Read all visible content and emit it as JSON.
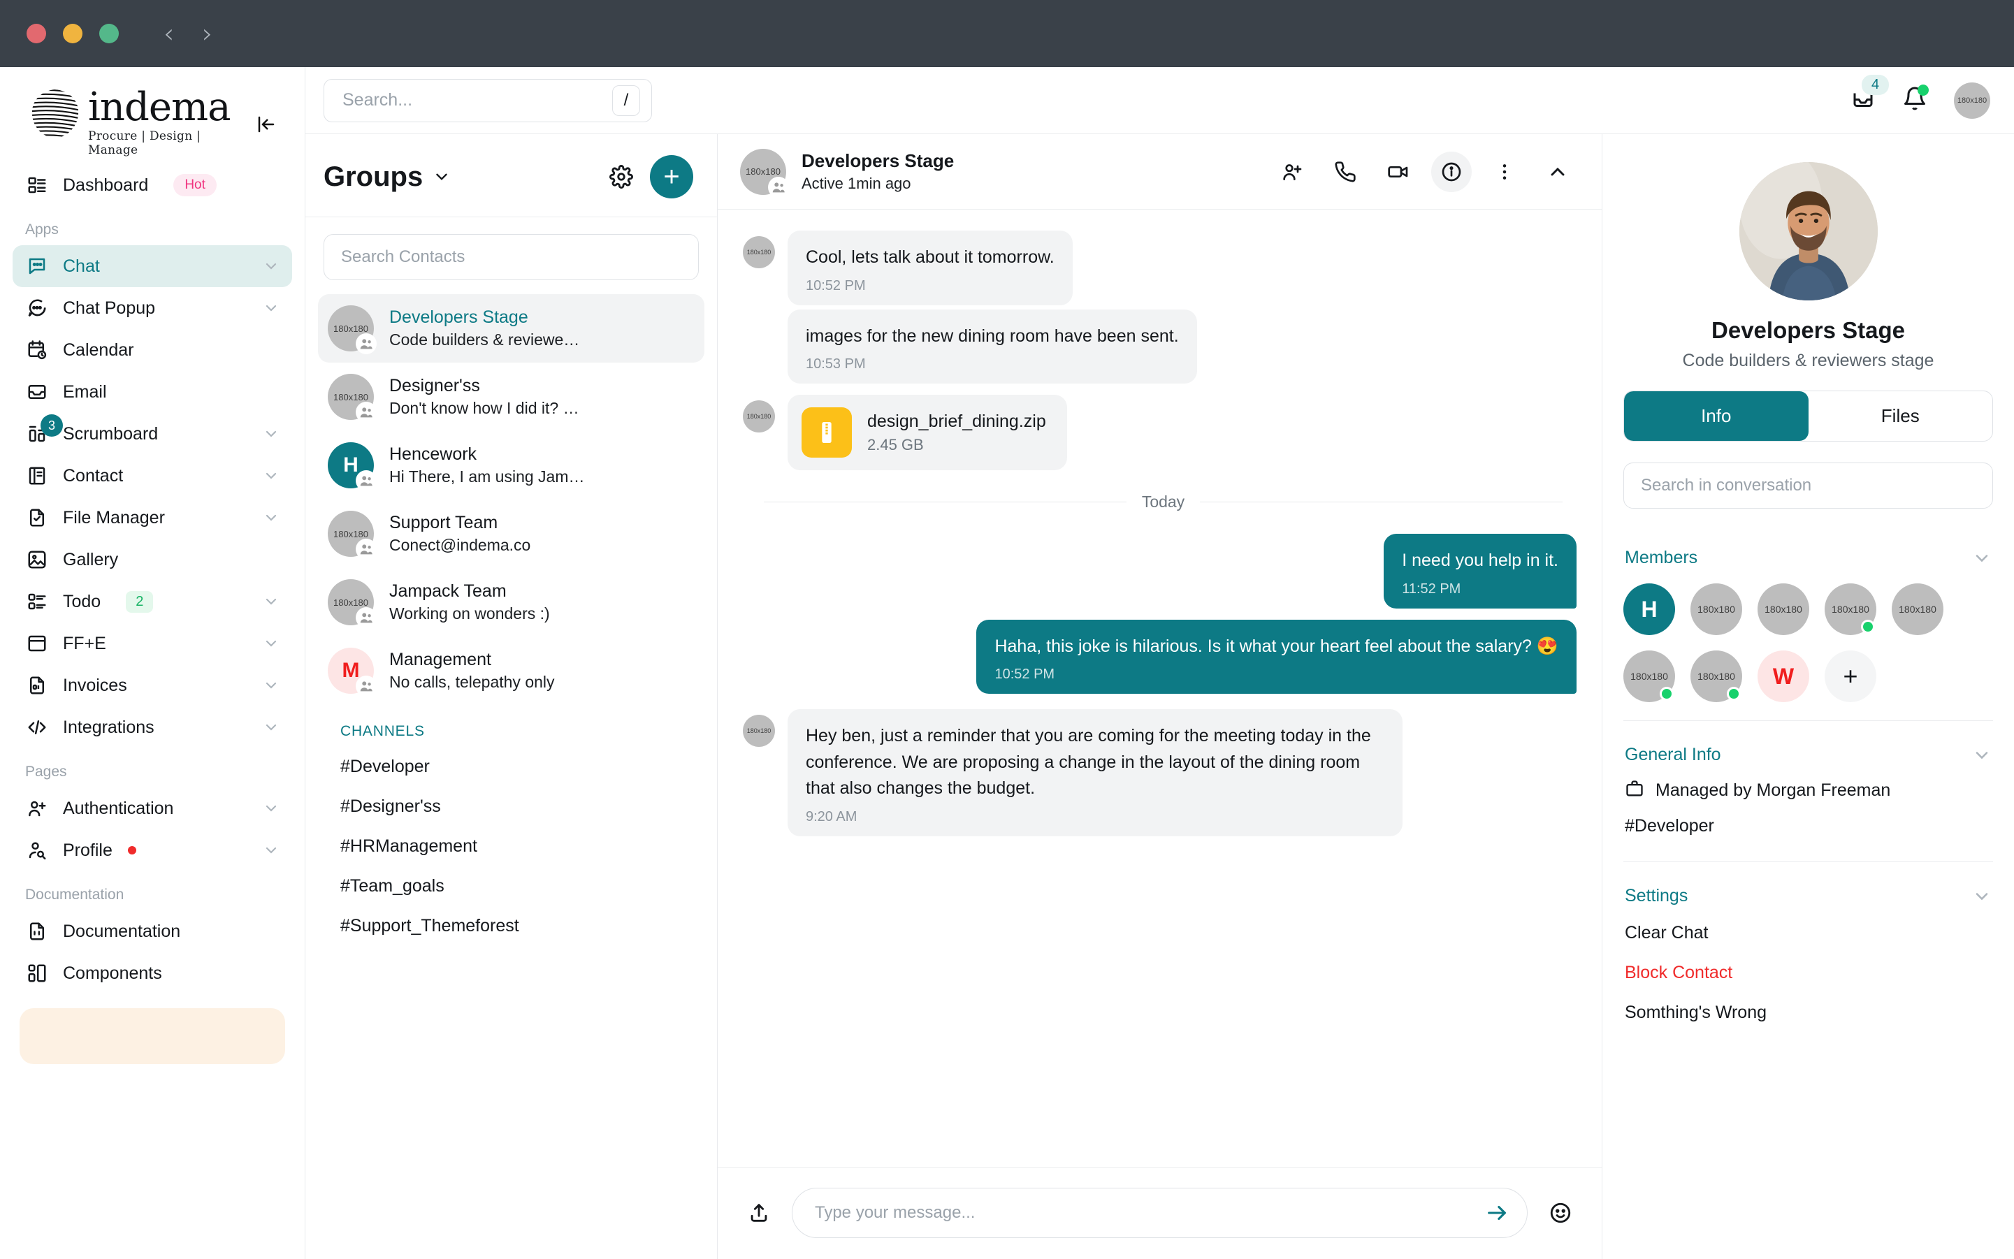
{
  "titlebar": {
    "traffic": [
      "close",
      "minimize",
      "maximize"
    ],
    "back_label": "‹",
    "forward_label": "›"
  },
  "sidebar": {
    "brand_name": "indema",
    "brand_tagline": "Procure | Design | Manage",
    "collapse_icon": "collapse-panel-icon",
    "dashboard": {
      "label": "Dashboard",
      "badge": "Hot"
    },
    "sections": [
      {
        "title": "Apps",
        "items": [
          {
            "label": "Chat",
            "icon": "chat-bubble-icon",
            "chevron": true,
            "active": true
          },
          {
            "label": "Chat Popup",
            "icon": "chat-dots-icon",
            "chevron": true
          },
          {
            "label": "Calendar",
            "icon": "calendar-clock-icon",
            "chevron": false
          },
          {
            "label": "Email",
            "icon": "inbox-icon",
            "chevron": false
          },
          {
            "label": "Scrumboard",
            "icon": "scrum-icon",
            "chevron": true,
            "badge": "3"
          },
          {
            "label": "Contact",
            "icon": "contact-book-icon",
            "chevron": true
          },
          {
            "label": "File Manager",
            "icon": "file-check-icon",
            "chevron": true
          },
          {
            "label": "Gallery",
            "icon": "image-icon",
            "chevron": false
          },
          {
            "label": "Todo",
            "icon": "todo-list-icon",
            "chevron": true,
            "count": "2"
          },
          {
            "label": "FF+E",
            "icon": "window-icon",
            "chevron": true
          },
          {
            "label": "Invoices",
            "icon": "invoice-icon",
            "chevron": true
          },
          {
            "label": "Integrations",
            "icon": "code-icon",
            "chevron": true
          }
        ]
      },
      {
        "title": "Pages",
        "items": [
          {
            "label": "Authentication",
            "icon": "user-plus-icon",
            "chevron": true
          },
          {
            "label": "Profile",
            "icon": "user-search-icon",
            "chevron": true,
            "dot": true
          }
        ]
      },
      {
        "title": "Documentation",
        "items": [
          {
            "label": "Documentation",
            "icon": "doc-code-icon",
            "chevron": false
          },
          {
            "label": "Components",
            "icon": "components-icon",
            "chevron": false
          }
        ]
      }
    ]
  },
  "topbar": {
    "search_placeholder": "Search...",
    "search_value": "",
    "search_shortcut": "/",
    "inbox_icon": "inbox-icon",
    "inbox_count": "4",
    "bell_icon": "bell-icon",
    "bell_has_alert": true,
    "user_avatar_label": "180x180"
  },
  "contacts_panel": {
    "title": "Groups",
    "title_chevron": "chevron-down-icon",
    "settings_icon": "gear-icon",
    "add_label": "+",
    "search_placeholder": "Search Contacts",
    "search_value": "",
    "items": [
      {
        "name": "Developers Stage",
        "preview": "Code builders & reviewe…",
        "avatar": "180x180",
        "avatar_kind": "image",
        "selected": true
      },
      {
        "name": "Designer'ss",
        "preview": "Don't know how I did it? …",
        "avatar": "180x180",
        "avatar_kind": "image"
      },
      {
        "name": "Hencework",
        "preview": "Hi There, I am using Jam…",
        "avatar": "H",
        "avatar_kind": "teal"
      },
      {
        "name": "Support Team",
        "preview": "Conect@indema.co",
        "avatar": "180x180",
        "avatar_kind": "image"
      },
      {
        "name": "Jampack Team",
        "preview": "Working on wonders :)",
        "avatar": "180x180",
        "avatar_kind": "image"
      },
      {
        "name": "Management",
        "preview": "No calls, telepathy only",
        "avatar": "M",
        "avatar_kind": "pink"
      }
    ],
    "channels_title": "CHANNELS",
    "channels": [
      "#Developer",
      "#Designer'ss",
      "#HRManagement",
      "#Team_goals",
      "#Support_Themeforest"
    ]
  },
  "chat": {
    "header": {
      "name": "Developers Stage",
      "status": "Active 1min ago",
      "avatar_label": "180x180",
      "actions": [
        {
          "name": "add-person-icon"
        },
        {
          "name": "phone-icon"
        },
        {
          "name": "video-icon"
        },
        {
          "name": "info-icon",
          "active": true
        },
        {
          "name": "more-vertical-icon"
        },
        {
          "name": "chevron-up-icon"
        }
      ]
    },
    "messages": [
      {
        "kind": "text",
        "dir": "in",
        "text": "Cool, lets talk about it tomorrow.",
        "time": "10:52 PM",
        "avatar_label": "180x180",
        "show_avatar": true
      },
      {
        "kind": "text",
        "dir": "in",
        "text": "images for the new dining room have been sent.",
        "time": "10:53 PM",
        "avatar_label": "180x180",
        "show_avatar": false
      },
      {
        "kind": "file",
        "dir": "in",
        "file_name": "design_brief_dining.zip",
        "file_size": "2.45 GB",
        "avatar_label": "180x180",
        "show_avatar": true,
        "file_icon": "zip-file-icon"
      },
      {
        "kind": "divider",
        "label": "Today"
      },
      {
        "kind": "text",
        "dir": "out",
        "text": "I need you help in it.",
        "time": "11:52 PM"
      },
      {
        "kind": "text",
        "dir": "out",
        "text": "Haha, this joke is hilarious. Is it what your heart feel about the salary? 😍",
        "time": "10:52 PM"
      },
      {
        "kind": "text",
        "dir": "in",
        "text": "Hey ben, just a reminder that you are coming for the meeting today in the conference. We are proposing a change in the layout of the dining room that also changes the budget.",
        "time": "9:20 AM",
        "avatar_label": "180x180",
        "show_avatar": true
      }
    ],
    "composer": {
      "attach_icon": "upload-icon",
      "placeholder": "Type your message...",
      "value": "",
      "send_icon": "send-arrow-icon",
      "emoji_icon": "emoji-icon"
    }
  },
  "right_panel": {
    "name": "Developers Stage",
    "subtitle": "Code builders & reviewers stage",
    "tabs": [
      {
        "label": "Info",
        "active": true
      },
      {
        "label": "Files",
        "active": false
      }
    ],
    "search_placeholder": "Search in conversation",
    "search_value": "",
    "members_title": "Members",
    "members": [
      {
        "label": "H",
        "kind": "teal",
        "online": false
      },
      {
        "label": "180x180",
        "kind": "image",
        "online": false
      },
      {
        "label": "180x180",
        "kind": "image",
        "online": false
      },
      {
        "label": "180x180",
        "kind": "image",
        "online": true
      },
      {
        "label": "180x180",
        "kind": "image",
        "online": false
      },
      {
        "label": "180x180",
        "kind": "image",
        "online": true
      },
      {
        "label": "180x180",
        "kind": "image",
        "online": true
      },
      {
        "label": "W",
        "kind": "pink",
        "online": false
      }
    ],
    "members_add_label": "+",
    "general_info_title": "General Info",
    "managed_by": "Managed by Morgan Freeman",
    "managed_icon": "briefcase-icon",
    "tag": "#Developer",
    "settings_title": "Settings",
    "settings_links": [
      {
        "label": "Clear Chat",
        "danger": false
      },
      {
        "label": "Block Contact",
        "danger": true
      },
      {
        "label": "Somthing's Wrong",
        "danger": false
      }
    ]
  },
  "colors": {
    "accent": "#0d7a85",
    "accent_soft": "#dfeeed",
    "hot_pink": "#f0337f",
    "danger": "#f02b2b",
    "online_green": "#18d16c",
    "zip_yellow": "#fcc018",
    "titlebar": "#3a4149"
  }
}
